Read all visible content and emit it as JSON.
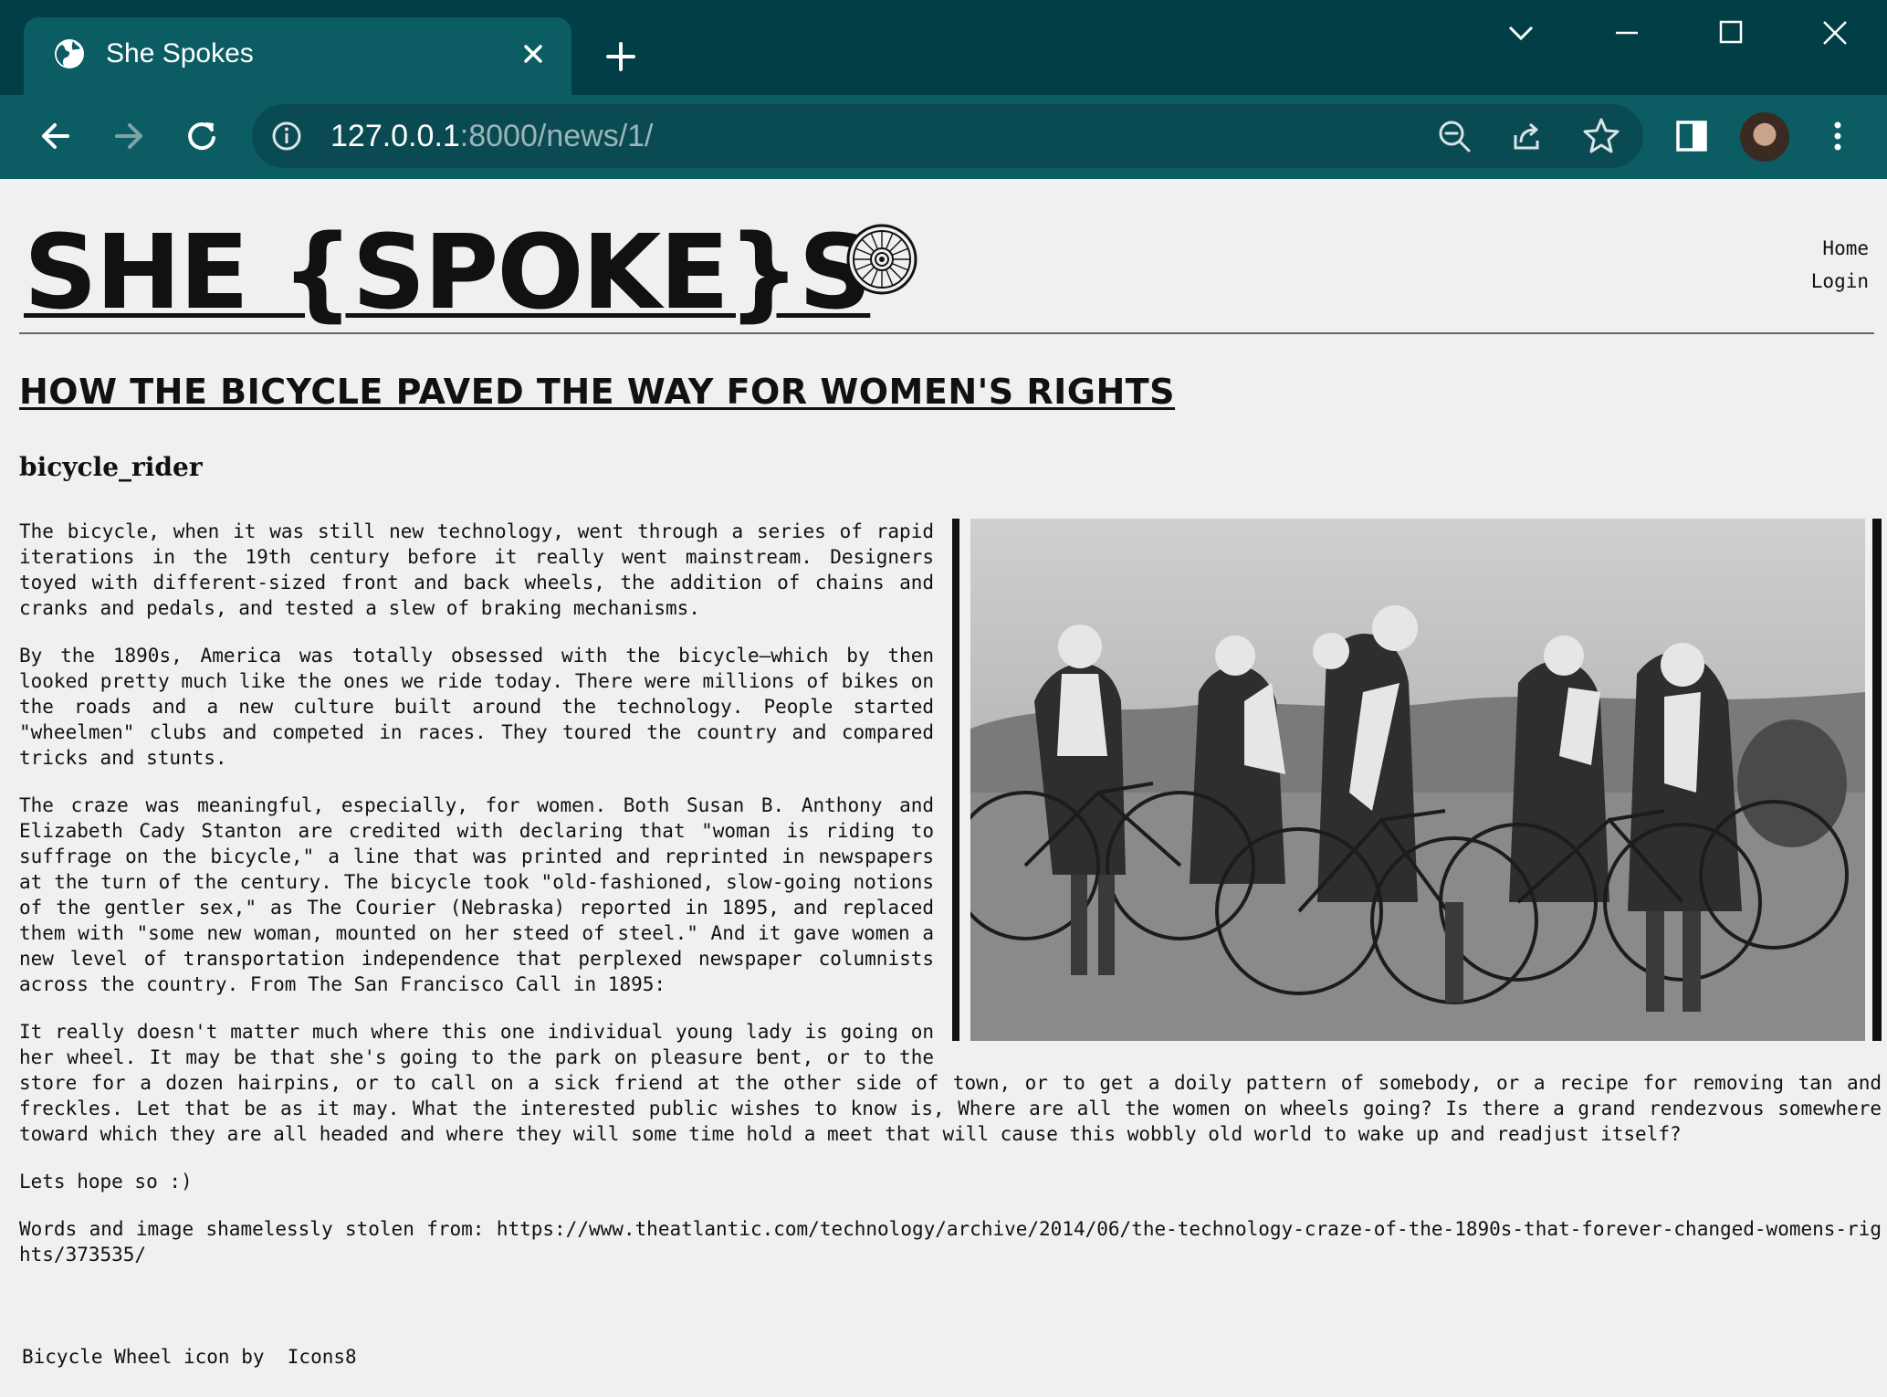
{
  "browser": {
    "tab_title": "She Spokes",
    "url_host": "127.0.0.1",
    "url_path": ":8000/news/1/",
    "icons": [
      "globe-icon",
      "close-icon",
      "plus-icon",
      "chevron-down-icon",
      "minimize-icon",
      "maximize-icon",
      "close-window-icon",
      "back-icon",
      "forward-icon",
      "reload-icon",
      "info-icon",
      "zoom-out-icon",
      "share-icon",
      "star-icon",
      "sidebar-icon",
      "profile-avatar",
      "menu-dots-icon"
    ],
    "colors": {
      "frame": "#023e45",
      "toolbar": "#0c5c63",
      "omnibox": "#0a4a52"
    }
  },
  "site": {
    "title": "SHE {SPOKE}S ",
    "logo_icon": "bicycle-wheel-icon",
    "nav": {
      "home": "Home",
      "login": "Login"
    }
  },
  "article": {
    "headline": "HOW THE BICYCLE PAVED THE WAY FOR WOMEN'S RIGHTS",
    "author": "bicycle_rider",
    "image_icon": "women-with-bicycles-photo",
    "paragraphs": [
      "The bicycle, when it was still new technology, went through a series of rapid iterations in the 19th century before it really went mainstream. Designers toyed with different-sized front and back wheels, the addition of chains and cranks and pedals, and tested a slew of braking mechanisms.",
      "By the 1890s, America was totally obsessed with the bicycle—which by then looked pretty much like the ones we ride today. There were millions of bikes on the roads and a new culture built around the technology. People started \"wheelmen\" clubs and competed in races. They toured the country and compared tricks and stunts.",
      "The craze was meaningful, especially, for women. Both Susan B. Anthony and Elizabeth Cady Stanton are credited with declaring that \"woman is riding to suffrage on the bicycle,\" a line that was printed and reprinted in newspapers at the turn of the century. The bicycle took \"old-fashioned, slow-going notions of the gentler sex,\" as The Courier (Nebraska) reported in 1895, and replaced them with \"some new woman, mounted on her steed of steel.\" And it gave women a new level of transportation independence that perplexed newspaper columnists across the country. From The San Francisco Call in 1895:",
      "It really doesn't matter much where this one individual young lady is going on her wheel. It may be that she's going to the park on pleasure bent, or to the store for a dozen hairpins, or to call on a sick friend at the other side of town, or to get a doily pattern of somebody, or a recipe for removing tan and freckles. Let that be as it may. What the interested public wishes to know is, Where are all the women on wheels going? Is there a grand rendezvous somewhere toward which they are all headed and where they will some time hold a meet that will cause this wobbly old world to wake up and readjust itself?",
      "Lets hope so :)",
      "Words and image shamelessly stolen from: https://www.theatlantic.com/technology/archive/2014/06/the-technology-craze-of-the-1890s-that-forever-changed-womens-rights/373535/"
    ]
  },
  "footer": {
    "credit": "Bicycle Wheel icon by  Icons8"
  }
}
